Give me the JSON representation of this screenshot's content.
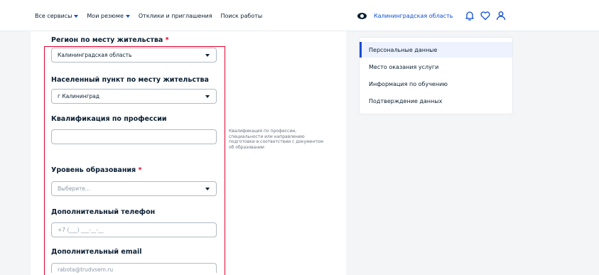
{
  "header": {
    "nav": [
      {
        "label": "Все сервисы",
        "dropdown": true
      },
      {
        "label": "Мои резюме",
        "dropdown": true
      },
      {
        "label": "Отклики и приглашения",
        "dropdown": false
      },
      {
        "label": "Поиск работы",
        "dropdown": false
      }
    ],
    "region": "Калининградская область",
    "icons": [
      "eye-icon",
      "bell-icon",
      "heart-icon",
      "user-icon"
    ]
  },
  "form": {
    "region": {
      "label": "Регион по месту жительства",
      "required_mark": "*",
      "value": "Калининградская область"
    },
    "locality": {
      "label": "Населенный пункт по месту жительства",
      "value": "г Калининград"
    },
    "qualification": {
      "label": "Квалификация по профессии",
      "value": "",
      "hint": "Квалификация по профессии, специальности или направлению подготовки в соответствии с документом об образовании"
    },
    "education": {
      "label": "Уровень образования",
      "required_mark": "*",
      "placeholder": "Выберите..."
    },
    "phone": {
      "label": "Дополнительный телефон",
      "placeholder": "+7 (___) ___-__-__"
    },
    "email": {
      "label": "Дополнительный email",
      "placeholder": "rabota@trudvsem.ru"
    }
  },
  "sidebar": {
    "items": [
      {
        "label": "Персональные данные",
        "active": true
      },
      {
        "label": "Место оказания услуги",
        "active": false
      },
      {
        "label": "Информация по обучению",
        "active": false
      },
      {
        "label": "Подтверждение данных",
        "active": false
      }
    ]
  },
  "colors": {
    "accent": "#0d4cd3",
    "required": "#e0002a",
    "highlight_border": "#e0002a",
    "active_item_bg": "#edf2fe"
  }
}
